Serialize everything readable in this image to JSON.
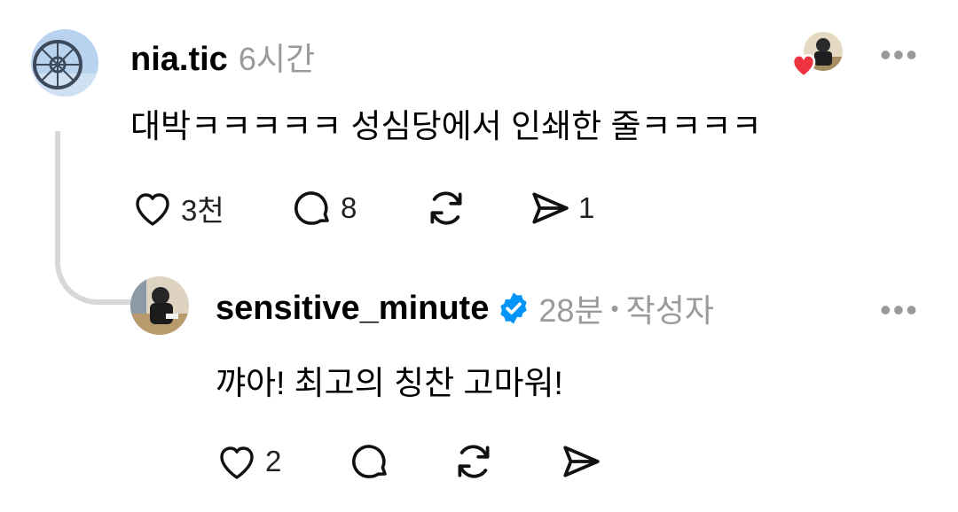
{
  "comment": {
    "username": "nia.tic",
    "time": "6시간",
    "text": "대박ㅋㅋㅋㅋㅋ 성심당에서 인쇄한 줄ㅋㅋㅋㅋ",
    "actions": {
      "like_count": "3천",
      "reply_count": "8",
      "share_count": "1"
    },
    "more_label": "•••",
    "liked_by_author": true
  },
  "reply": {
    "username": "sensitive_minute",
    "verified": true,
    "time": "28분",
    "separator": "•",
    "author_badge": "작성자",
    "text": "꺄아! 최고의 칭찬 고마워!",
    "actions": {
      "like_count": "2"
    },
    "more_label": "•••"
  },
  "colors": {
    "heart": "#ee3340",
    "verified": "#0095f6",
    "meta": "#9a9a9a",
    "thread_line": "#d8d8d8"
  }
}
